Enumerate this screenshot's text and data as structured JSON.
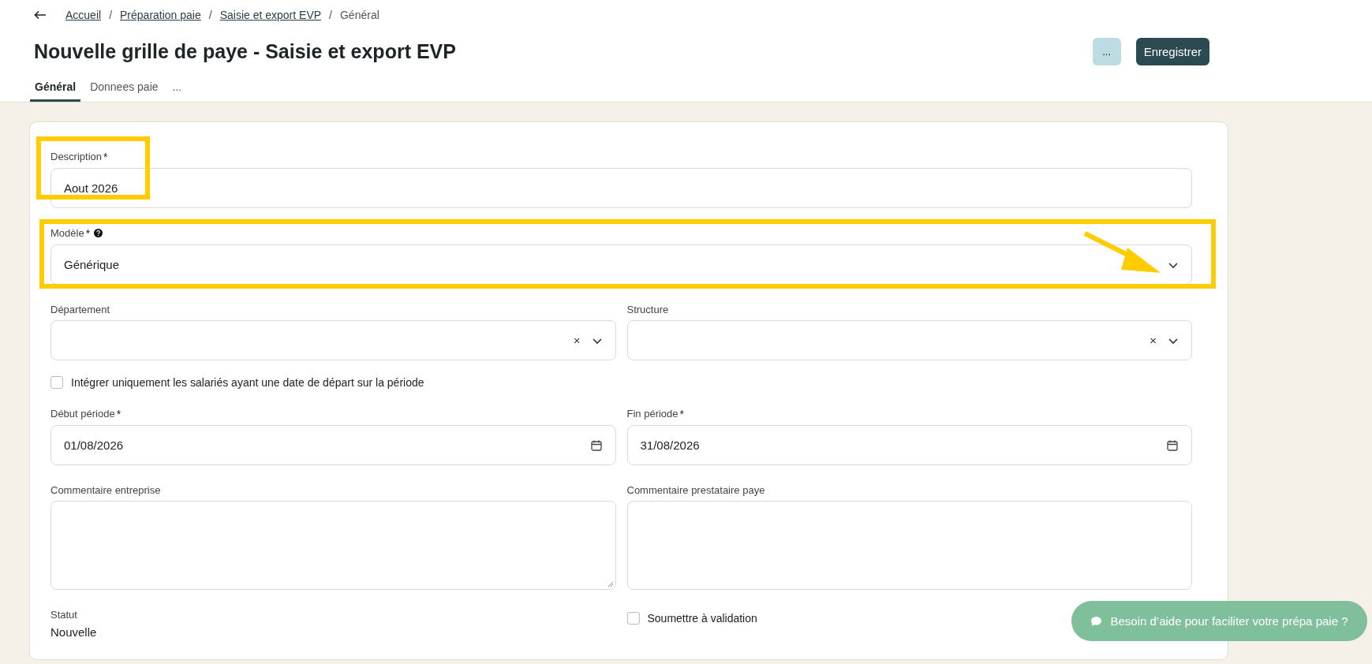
{
  "breadcrumb": [
    {
      "label": "Accueil",
      "link": true
    },
    {
      "label": "Préparation paie",
      "link": true
    },
    {
      "label": "Saisie et export EVP",
      "link": true
    },
    {
      "label": "Général",
      "link": false
    }
  ],
  "breadcrumb_separators": [
    "/",
    "/",
    "/"
  ],
  "title": "Nouvelle grille de paye - Saisie et export EVP",
  "actions": [
    {
      "kind": "more",
      "label": "..."
    },
    {
      "kind": "primary",
      "label": "Enregistrer"
    }
  ],
  "tabs": [
    {
      "label": "Général",
      "selected": true
    },
    {
      "label": "Donnees paie",
      "selected": false
    },
    {
      "label": "...",
      "selected": false
    }
  ],
  "form": {
    "description": {
      "label": "Description",
      "required_mark": "*",
      "value": "Aout 2026",
      "highlighted": true
    },
    "model": {
      "label": "Modèle",
      "required_mark": "*",
      "help": true,
      "value": "Générique",
      "highlighted": true
    },
    "row_selects": [
      {
        "label": "Département",
        "clear": "×"
      },
      {
        "label": "Structure",
        "clear": "×"
      }
    ],
    "checkbox": {
      "label": "Intégrer uniquement les salariés ayant une date de départ sur la période",
      "checked": false
    },
    "dates": [
      {
        "label": "Début période",
        "required_mark": "*",
        "value": "01/08/2026"
      },
      {
        "label": "Fin période",
        "required_mark": "*",
        "value": "31/08/2026"
      }
    ],
    "comments": [
      {
        "label": "Commentaire entreprise"
      },
      {
        "label": "Commentaire prestataire paye"
      }
    ],
    "status": {
      "label": "Statut",
      "value": "Nouvelle"
    },
    "submit": {
      "label": "Soumettre à validation",
      "checked": false
    }
  },
  "help_button": "Besoin d’aide pour faciliter votre prépa paie ?"
}
